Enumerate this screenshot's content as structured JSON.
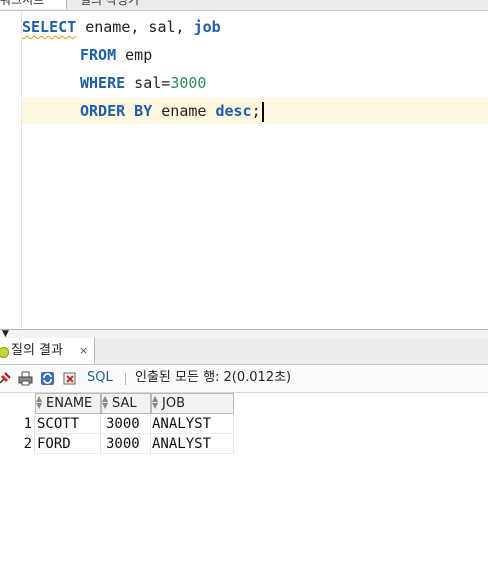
{
  "top_tabs": [
    "워크시트",
    "질의 작성기"
  ],
  "editor": {
    "line1": {
      "kw1": "SELECT",
      "rest": " ename, sal, ",
      "kw2": "job"
    },
    "line2": {
      "kw": "FROM",
      "rest": " emp"
    },
    "line3": {
      "kw": "WHERE",
      "rest": " sal=",
      "num": "3000"
    },
    "line4": {
      "kw1": "ORDER BY",
      "rest": " ename ",
      "kw2": "desc",
      "tail": ";"
    }
  },
  "result_tab": {
    "label": "질의 결과",
    "close": "×"
  },
  "toolbar": {
    "sql_label": "SQL",
    "separator": "|",
    "status": "인출된 모든 행: 2(0.012초)"
  },
  "grid": {
    "columns": [
      "ENAME",
      "SAL",
      "JOB"
    ],
    "rows": [
      {
        "num": "1",
        "ename": "SCOTT",
        "sal": "3000",
        "job": "ANALYST"
      },
      {
        "num": "2",
        "ename": "FORD",
        "sal": "3000",
        "job": "ANALYST"
      }
    ]
  },
  "colors": {
    "keyword": "#1f5fa6",
    "number": "#2e8b57",
    "current_line": "#fff8e0"
  },
  "icons": [
    "pin-icon",
    "print-icon",
    "refresh-icon",
    "export-icon"
  ]
}
